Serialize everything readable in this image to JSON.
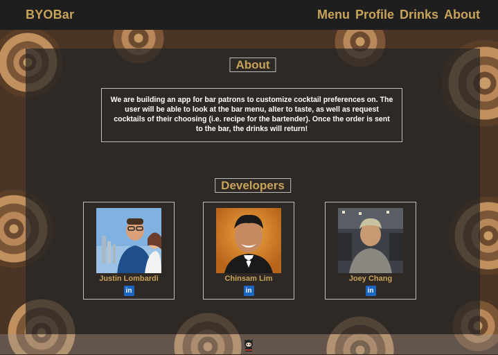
{
  "navbar": {
    "brand": "BYOBar",
    "links": [
      "Menu",
      "Profile",
      "Drinks",
      "About"
    ]
  },
  "about": {
    "title": "About",
    "description": "We are building an app for bar patrons to customize cocktail preferences on. The user will be able to look at the bar menu, alter to taste, as well as request cocktails of their choosing (i.e. recipe for the bartender). Once the order is sent to the bar, the drinks will return!"
  },
  "developers": {
    "title": "Developers",
    "people": [
      {
        "name": "Justin Lombardi",
        "link_icon": "linkedin-icon"
      },
      {
        "name": "Chinsam Lim",
        "link_icon": "linkedin-icon"
      },
      {
        "name": "Joey Chang",
        "link_icon": "linkedin-icon"
      }
    ]
  },
  "footer": {
    "icon": "github-octocat-icon"
  },
  "colors": {
    "accent": "#c8a45a",
    "navbar_bg": "#1e1e1e",
    "linkedin": "#1a66c2",
    "text": "#ffffff"
  }
}
